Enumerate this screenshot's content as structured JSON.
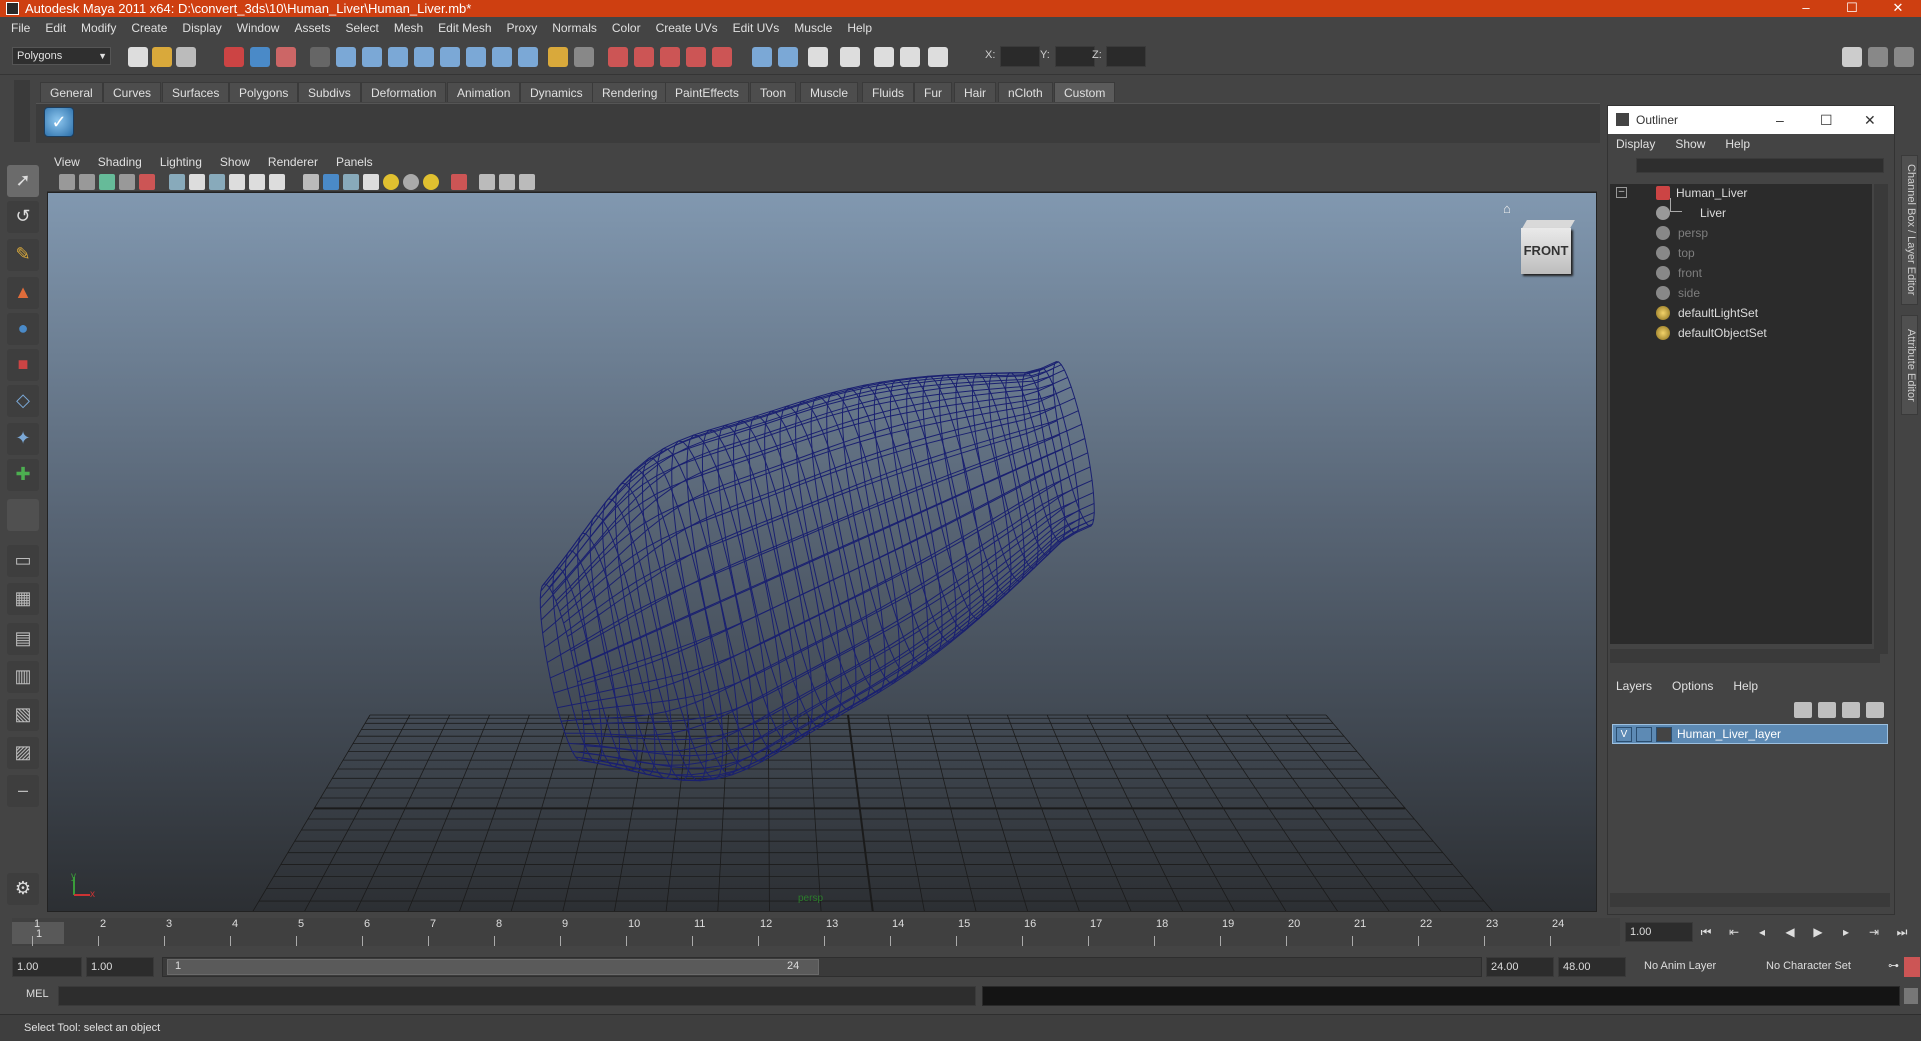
{
  "window": {
    "title": "Autodesk Maya 2011 x64: D:\\convert_3ds\\10\\Human_Liver\\Human_Liver.mb*",
    "minimize": "–",
    "maximize": "☐",
    "close": "✕"
  },
  "menubar": [
    "File",
    "Edit",
    "Modify",
    "Create",
    "Display",
    "Window",
    "Assets",
    "Select",
    "Mesh",
    "Edit Mesh",
    "Proxy",
    "Normals",
    "Color",
    "Create UVs",
    "Edit UVs",
    "Muscle",
    "Help"
  ],
  "statusline": {
    "menuset": "Polygons",
    "x_label": "X:",
    "y_label": "Y:",
    "z_label": "Z:"
  },
  "shelf": {
    "tabs": [
      "General",
      "Curves",
      "Surfaces",
      "Polygons",
      "Subdivs",
      "Deformation",
      "Animation",
      "Dynamics",
      "Rendering",
      "PaintEffects",
      "Toon",
      "Muscle",
      "Fluids",
      "Fur",
      "Hair",
      "nCloth",
      "Custom"
    ],
    "active_tab": "Custom",
    "button_icon": "checkmark-icon"
  },
  "viewport": {
    "menu": [
      "View",
      "Shading",
      "Lighting",
      "Show",
      "Renderer",
      "Panels"
    ],
    "viewcube_label": "FRONT",
    "camera_label": "persp",
    "axis_y": "y",
    "axis_x": "x",
    "wire_color": "#1a2070",
    "grid_color": "#1b1b1b"
  },
  "outliner": {
    "title": "Outliner",
    "menu": [
      "Display",
      "Show",
      "Help"
    ],
    "items": [
      {
        "label": "Human_Liver",
        "icon": "transform-icon",
        "dim": false,
        "expanded": true,
        "indent": 0
      },
      {
        "label": "Liver",
        "icon": "mesh-icon",
        "dim": false,
        "indent": 1
      },
      {
        "label": "persp",
        "icon": "camera-icon",
        "dim": true,
        "indent": 0
      },
      {
        "label": "top",
        "icon": "camera-icon",
        "dim": true,
        "indent": 0
      },
      {
        "label": "front",
        "icon": "camera-icon",
        "dim": true,
        "indent": 0
      },
      {
        "label": "side",
        "icon": "camera-icon",
        "dim": true,
        "indent": 0
      },
      {
        "label": "defaultLightSet",
        "icon": "set-icon",
        "dim": false,
        "indent": 0
      },
      {
        "label": "defaultObjectSet",
        "icon": "set-icon",
        "dim": false,
        "indent": 0
      }
    ]
  },
  "layers": {
    "menu": [
      "Layers",
      "Options",
      "Help"
    ],
    "layer_name": "Human_Liver_layer",
    "visibility": "V"
  },
  "sidetabs": [
    "Channel Box / Layer Editor",
    "Attribute Editor"
  ],
  "timeslider": {
    "ticks": [
      "1",
      "2",
      "3",
      "4",
      "5",
      "6",
      "7",
      "8",
      "9",
      "10",
      "11",
      "12",
      "13",
      "14",
      "15",
      "16",
      "17",
      "18",
      "19",
      "20",
      "21",
      "22",
      "23",
      "24"
    ],
    "current_frame_marker": "1",
    "current_frame": "1.00"
  },
  "rangebar": {
    "start": "1.00",
    "range_start": "1.00",
    "slider_start": "1",
    "slider_end": "24",
    "range_end": "24.00",
    "end": "48.00",
    "anim_layer": "No Anim Layer",
    "character_set": "No Character Set"
  },
  "cmdline": {
    "label": "MEL"
  },
  "helpline": {
    "text": "Select Tool: select an object"
  }
}
